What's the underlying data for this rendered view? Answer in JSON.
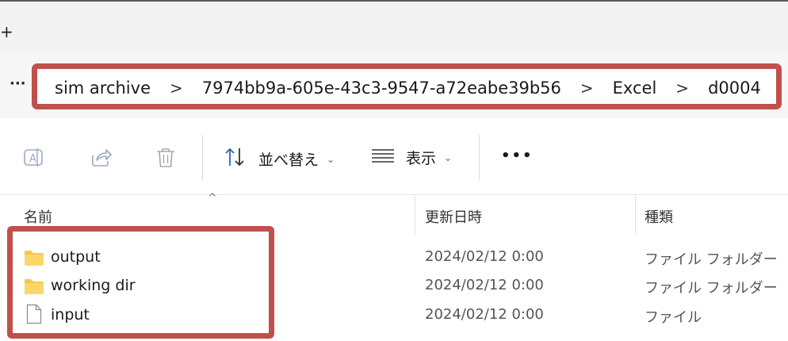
{
  "titlebar": {
    "new_tab_glyph": "+"
  },
  "address_bar": {
    "overflow_glyph": "···",
    "crumbs": [
      "sim archive",
      "7974bb9a-605e-43c3-9547-a72eabe39b56",
      "Excel",
      "d0004"
    ],
    "separator": ">"
  },
  "command_bar": {
    "icons": [
      "rename-icon",
      "share-icon",
      "delete-icon"
    ],
    "sort_label": "並べ替え",
    "view_label": "表示",
    "more_glyph": "•••"
  },
  "columns": {
    "name": "名前",
    "date": "更新日時",
    "type": "種類"
  },
  "files": [
    {
      "name": "output",
      "date": "2024/02/12 0:00",
      "type": "ファイル フォルダー",
      "icon": "folder-icon"
    },
    {
      "name": "working dir",
      "date": "2024/02/12 0:00",
      "type": "ファイル フォルダー",
      "icon": "folder-icon"
    },
    {
      "name": "input",
      "date": "2024/02/12 0:00",
      "type": "ファイル",
      "icon": "file-icon"
    }
  ],
  "colors": {
    "highlight": "#c0504d",
    "folder": "#f8c74a"
  }
}
